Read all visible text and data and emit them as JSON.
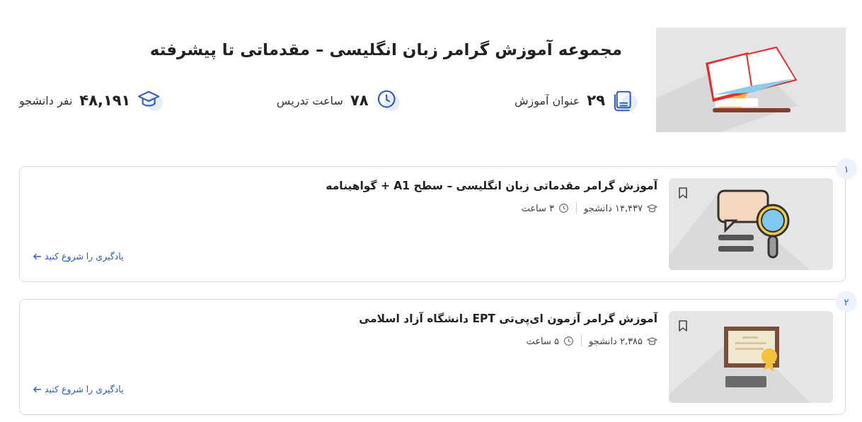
{
  "header": {
    "title": "مجموعه آموزش گرامر زبان انگلیسی – مقدماتی تا پیشرفته",
    "stats": [
      {
        "kind": "books",
        "value": "۲۹",
        "label": "عنوان آموزش"
      },
      {
        "kind": "clock",
        "value": "۷۸",
        "label": "ساعت تدریس"
      },
      {
        "kind": "students",
        "value": "۴۸,۱۹۱",
        "label": "نفر دانشجو"
      }
    ]
  },
  "courses": [
    {
      "number": "۱",
      "title": "آموزش گرامر مقدماتی زبان انگلیسی – سطح A1 + گواهینامه",
      "students": "۱۴,۴۳۷ دانشجو",
      "duration": "۳ ساعت",
      "link": "یادگیری را شروع کنید"
    },
    {
      "number": "۲",
      "title": "آموزش گرامر آزمون ای‌پی‌تی EPT دانشگاه آزاد اسلامی",
      "students": "۲,۳۸۵ دانشجو",
      "duration": "۵ ساعت",
      "link": "یادگیری را شروع کنید"
    }
  ]
}
